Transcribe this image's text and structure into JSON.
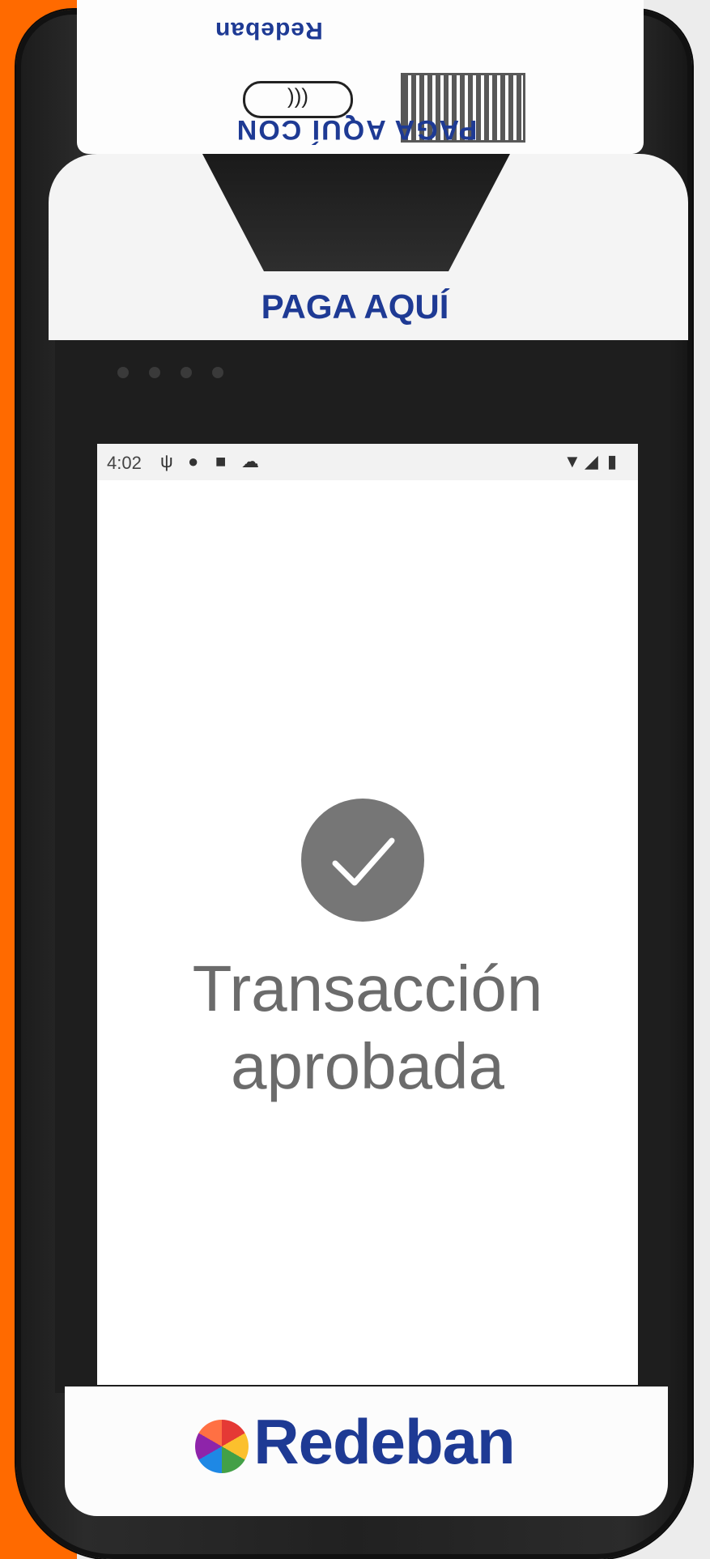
{
  "device": {
    "brand_top": "Redeban",
    "sticker_text": "PAGA AQUÍ CON",
    "label_above_screen": "PAGA AQUÍ",
    "brand_bottom": "Redeban"
  },
  "statusbar": {
    "time": "4:02",
    "icons": [
      "usb-icon",
      "logo-icon",
      "sdcard-icon",
      "cloud-icon",
      "wifi-icon",
      "signal-icon",
      "battery-icon"
    ]
  },
  "screen": {
    "status_icon": "check-icon",
    "message_line1": "Transacción",
    "message_line2": "aprobada"
  },
  "colors": {
    "accent": "#ff6a00",
    "brand": "#1e3a94",
    "check_bg": "#767676",
    "message": "#6b6b6b"
  }
}
